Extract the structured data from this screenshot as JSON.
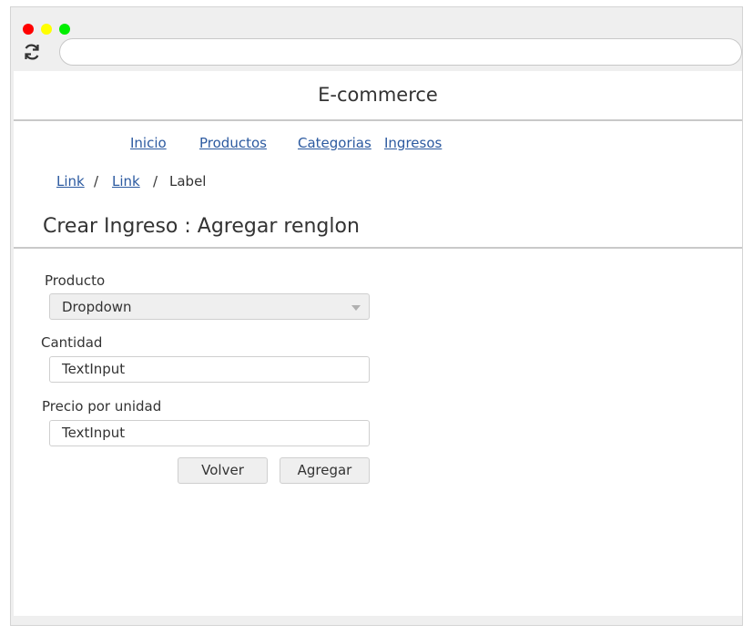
{
  "browser": {
    "controls": [
      "close",
      "minimize",
      "maximize"
    ],
    "reload_icon": "reload-icon",
    "address": ""
  },
  "header": {
    "title": "E-commerce"
  },
  "nav": {
    "items": [
      "Inicio",
      "Productos",
      "Categorias",
      "Ingresos"
    ]
  },
  "breadcrumb": {
    "items": [
      "Link",
      "Link",
      "Label"
    ],
    "separator": "/"
  },
  "page": {
    "title": "Crear Ingreso : Agregar renglon"
  },
  "form": {
    "producto_label": "Producto",
    "producto_value": "Dropdown",
    "cantidad_label": "Cantidad",
    "cantidad_value": "TextInput",
    "precio_label": "Precio por unidad",
    "precio_value": "TextInput",
    "volver_label": "Volver",
    "agregar_label": "Agregar"
  },
  "colors": {
    "link": "#2c5aa0",
    "traffic_red": "#ff0000",
    "traffic_yellow": "#ffff00",
    "traffic_green": "#00ee00"
  }
}
